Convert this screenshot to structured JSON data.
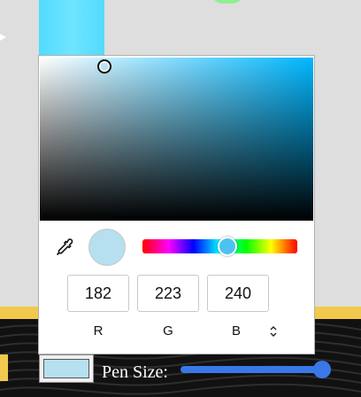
{
  "app": {
    "pen_label": "Pen Size:",
    "pen_size_level": 0.95
  },
  "color_picker": {
    "hue_deg": 197,
    "saturation": 0.24,
    "brightness": 0.94,
    "preview_color": "#b6dff0",
    "rgb": {
      "r_value": "182",
      "g_value": "223",
      "b_value": "240",
      "r_label": "R",
      "g_label": "G",
      "b_label": "B"
    },
    "icons": {
      "eyedropper": "eyedropper-icon",
      "format_toggle": "updown-chevron-icon"
    }
  },
  "colors": {
    "selected_color": "#b6dff0",
    "slider_accent": "#3a78e8",
    "footer_accent": "#f2c94c",
    "footer_background": "#111111",
    "canvas_background": "#dedede"
  }
}
